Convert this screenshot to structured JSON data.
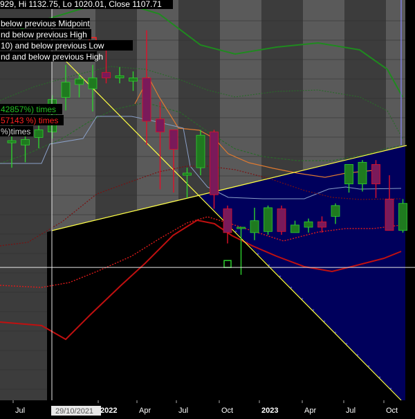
{
  "header": {
    "ohlc_text": "929, Hi 1132.75, Lo 1020.01, Close 1107.71"
  },
  "legend_lines": [
    {
      "text": "below previous Midpoint",
      "color": "#ffffff"
    },
    {
      "text": "nd below previous High",
      "color": "#ffffff"
    },
    {
      "text": "10) and below previous Low",
      "color": "#ffffff"
    },
    {
      "text": "nd and below previous High",
      "color": "#ffffff"
    }
  ],
  "stats_lines": [
    {
      "text": "42857%) times",
      "color": "#22c022"
    },
    {
      "text": "57143 %) times",
      "color": "#ff2020"
    },
    {
      "text": "%)times",
      "color": "#d8d8d8"
    }
  ],
  "crosshair_date": "29/10/2021",
  "colors": {
    "background": "#000000",
    "band_dark": "#3c3c3c",
    "band_light": "#5a5a5a",
    "projection_fill": "#00005c",
    "trendline": "#ffff44",
    "up_candle": "#1f7a1f",
    "up_wick": "#2ed12e",
    "down_candle": "#7a1a5a",
    "down_wick": "#e0102a",
    "outer_band": "#1f8a1f",
    "inner_band": "#2a6a2a",
    "lower_red": "#c01010",
    "lower_red_dotted": "#e01a1a",
    "orange_line": "#e07a30",
    "blue_line": "#8aa0c8",
    "dark_red_dotted": "#7a1010"
  },
  "chart_data": {
    "type": "candlestick",
    "x_tick_labels": [
      "Jul",
      "2022",
      "Apr",
      "Jul",
      "Oct",
      "2023",
      "Apr",
      "Jul",
      "Oct"
    ],
    "candles": [
      {
        "i": 0,
        "open": 1068,
        "high": 1095,
        "low": 1045,
        "close": 1070
      },
      {
        "i": 1,
        "open": 1066,
        "high": 1078,
        "low": 1050,
        "close": 1071
      },
      {
        "i": 2,
        "open": 1073,
        "high": 1084,
        "low": 1063,
        "close": 1080
      },
      {
        "i": 3,
        "open": 1078,
        "high": 1112,
        "low": 1072,
        "close": 1108
      },
      {
        "i": 4,
        "open": 1110,
        "high": 1140,
        "low": 1098,
        "close": 1124
      },
      {
        "i": 5,
        "open": 1122,
        "high": 1132,
        "low": 1110,
        "close": 1127
      },
      {
        "i": 6,
        "open": 1118,
        "high": 1140,
        "low": 1097,
        "close": 1128
      },
      {
        "i": 7,
        "open": 1133,
        "high": 1158,
        "low": 1123,
        "close": 1128
      },
      {
        "i": 8,
        "open": 1128,
        "high": 1138,
        "low": 1123,
        "close": 1130
      },
      {
        "i": 9,
        "open": 1125,
        "high": 1134,
        "low": 1116,
        "close": 1128
      },
      {
        "i": 10,
        "open": 1128,
        "high": 1172,
        "low": 1066,
        "close": 1088
      },
      {
        "i": 11,
        "open": 1090,
        "high": 1106,
        "low": 1025,
        "close": 1078
      },
      {
        "i": 12,
        "open": 1080,
        "high": 1080,
        "low": 1022,
        "close": 1062
      },
      {
        "i": 13,
        "open": 1038,
        "high": 1045,
        "low": 1017,
        "close": 1040
      },
      {
        "i": 14,
        "open": 1045,
        "high": 1080,
        "low": 1038,
        "close": 1075
      },
      {
        "i": 15,
        "open": 1078,
        "high": 1080,
        "low": 1007,
        "close": 1020
      },
      {
        "i": 16,
        "open": 1007,
        "high": 1010,
        "low": 975,
        "close": 985
      },
      {
        "i": 17,
        "open": 990,
        "high": 990,
        "low": 946,
        "close": 990
      },
      {
        "i": 18,
        "open": 985,
        "high": 1008,
        "low": 978,
        "close": 996
      },
      {
        "i": 19,
        "open": 986,
        "high": 1010,
        "low": 983,
        "close": 1008
      },
      {
        "i": 20,
        "open": 1007,
        "high": 1010,
        "low": 983,
        "close": 986
      },
      {
        "i": 21,
        "open": 985,
        "high": 996,
        "low": 985,
        "close": 992
      },
      {
        "i": 22,
        "open": 990,
        "high": 998,
        "low": 985,
        "close": 995
      },
      {
        "i": 23,
        "open": 995,
        "high": 1000,
        "low": 985,
        "close": 990
      },
      {
        "i": 24,
        "open": 1000,
        "high": 1012,
        "low": 993,
        "close": 1010
      },
      {
        "i": 25,
        "open": 1030,
        "high": 1048,
        "low": 1022,
        "close": 1048
      },
      {
        "i": 26,
        "open": 1030,
        "high": 1052,
        "low": 1023,
        "close": 1050
      },
      {
        "i": 27,
        "open": 1048,
        "high": 1052,
        "low": 1017,
        "close": 1030
      },
      {
        "i": 28,
        "open": 1016,
        "high": 1038,
        "low": 987,
        "close": 987
      },
      {
        "i": 29,
        "open": 987,
        "high": 1016,
        "low": 985,
        "close": 1012
      }
    ],
    "crosshair_price": 956,
    "y_range": [
      830,
      1200
    ]
  }
}
